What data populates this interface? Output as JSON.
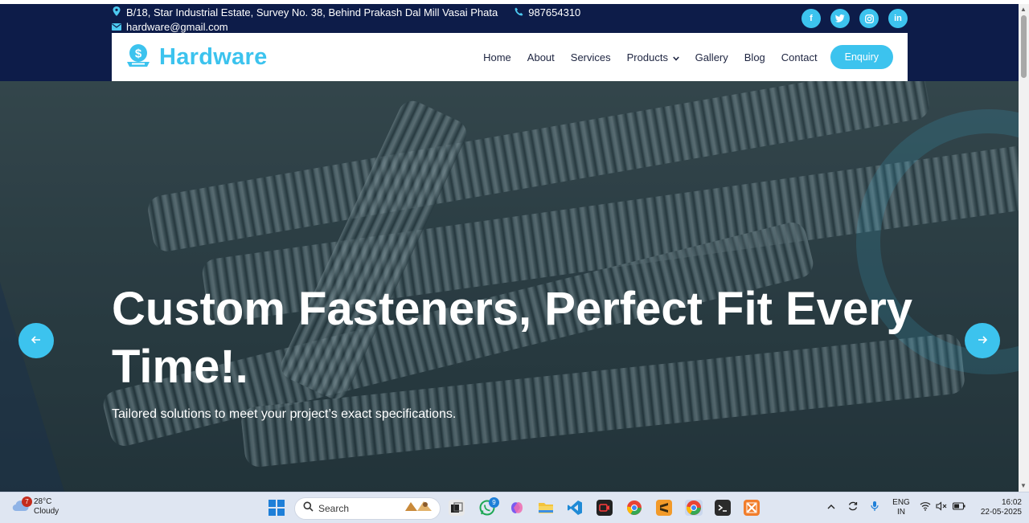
{
  "header": {
    "address": "B/18, Star Industrial Estate, Survey No. 38, Behind Prakash Dal Mill Vasai Phata",
    "phone": "987654310",
    "email": "hardware@gmail.com",
    "social": [
      "f",
      "t",
      "ig",
      "in"
    ]
  },
  "brand": {
    "name": "Hardware",
    "accent": "#3cc3ee"
  },
  "nav": {
    "items": [
      "Home",
      "About",
      "Services",
      "Products",
      "Gallery",
      "Blog",
      "Contact"
    ],
    "enquiry": "Enquiry"
  },
  "hero": {
    "title": "Custom Fasteners, Perfect Fit Every Time!.",
    "subtitle": "Tailored solutions to meet your project’s exact specifications.",
    "prev_icon": "arrow-left-icon",
    "next_icon": "arrow-right-icon"
  },
  "taskbar": {
    "weather_temp": "28°C",
    "weather_cond": "Cloudy",
    "weather_badge": "7",
    "search_label": "Search",
    "whatsapp_badge": "9",
    "lang_1": "ENG",
    "lang_2": "IN",
    "time": "16:02",
    "date": "22-05-2025"
  }
}
